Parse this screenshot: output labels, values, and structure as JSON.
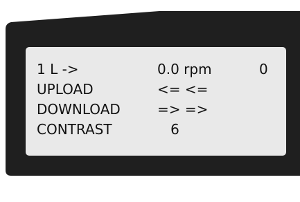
{
  "display": {
    "rows": [
      {
        "label": "1 L ->",
        "value": "0.0 rpm",
        "extra": "0"
      },
      {
        "label": "UPLOAD",
        "value": "<= <="
      },
      {
        "label": "DOWNLOAD",
        "value": "=> =>"
      },
      {
        "label": "CONTRAST",
        "value": "   6"
      }
    ]
  },
  "colors": {
    "bezel": "#1f1f1f",
    "screen": "#e9e9e9",
    "text": "#111111"
  }
}
